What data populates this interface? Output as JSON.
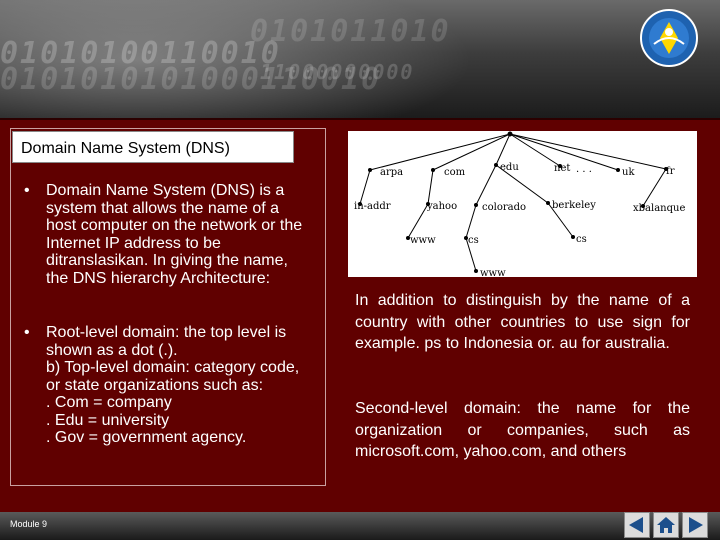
{
  "slide": {
    "title": "Domain Name System (DNS)",
    "bullets": [
      {
        "symbol": "•",
        "text": "Domain Name System (DNS) is a system that allows the name of a host computer on the network or the Internet IP address to be ditranslasikan. In giving the name, the DNS hierarchy Architecture:"
      },
      {
        "symbol": "•",
        "text": "Root-level domain: the top level is shown as a dot (.).\nb) Top-level domain: category code, or state organizations such as:\n. Com = company\n. Edu = university\n. Gov = government agency."
      }
    ],
    "right_paragraphs": [
      "In addition to distinguish by the name of a country with other countries to use sign for example. ps to Indonesia or. au for australia.",
      "Second-level domain: the name for the organization or companies, such as microsoft.com, yahoo.com, and others"
    ],
    "footer_module": "Module 9"
  },
  "dns_tree": {
    "top_level": [
      "arpa",
      "com",
      "edu",
      "net",
      "· · ·",
      "uk",
      "fr"
    ],
    "second_level": [
      "in-addr",
      "yahoo",
      "colorado",
      "berkeley",
      "xbalanque"
    ],
    "third_level": [
      "www",
      "cs",
      "cs"
    ],
    "fourth_level": [
      "www"
    ]
  },
  "header": {
    "binary_rows": [
      "01010100110010",
      "0101010101000110010",
      "0101011010",
      "11000000000"
    ]
  },
  "nav": {
    "prev_icon": "arrow-left-icon",
    "home_icon": "home-icon",
    "next_icon": "arrow-right-icon"
  },
  "colors": {
    "background": "#5c0000",
    "text": "#ffffff",
    "title_box": "#ffffff"
  }
}
